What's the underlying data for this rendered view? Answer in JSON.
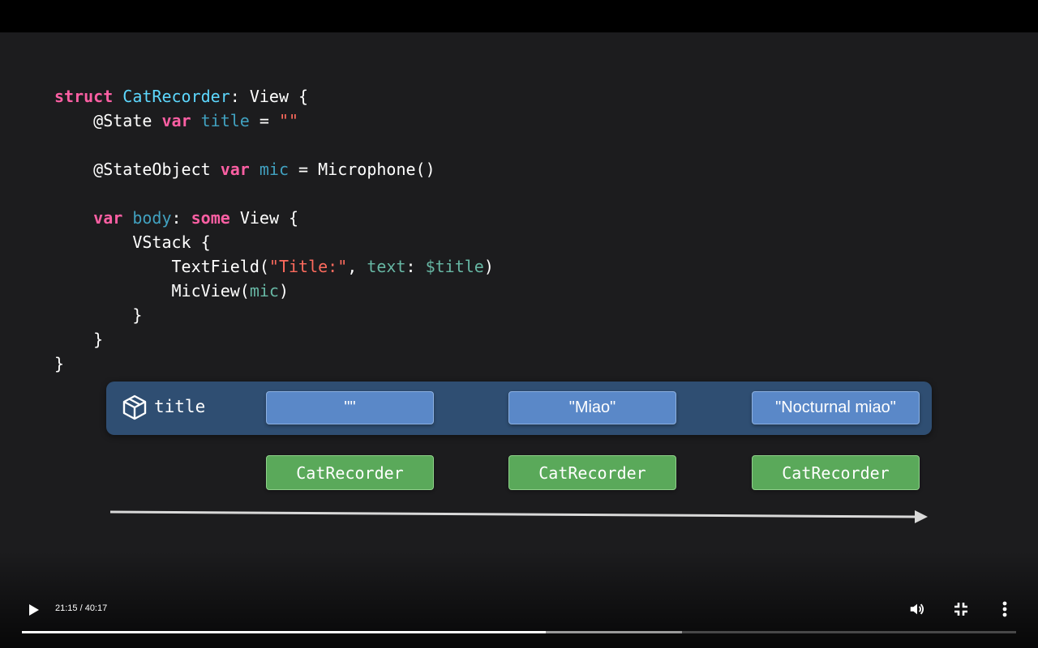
{
  "code": {
    "lines": [
      [
        {
          "c": "k",
          "t": "struct"
        },
        {
          "c": "w",
          "t": " "
        },
        {
          "c": "t",
          "t": "CatRecorder"
        },
        {
          "c": "w",
          "t": ": View {"
        }
      ],
      [
        {
          "c": "w",
          "t": "    @State "
        },
        {
          "c": "k",
          "t": "var"
        },
        {
          "c": "w",
          "t": " "
        },
        {
          "c": "v",
          "t": "title"
        },
        {
          "c": "w",
          "t": " = "
        },
        {
          "c": "s",
          "t": "\"\""
        }
      ],
      [
        {
          "c": "w",
          "t": ""
        }
      ],
      [
        {
          "c": "w",
          "t": "    @StateObject "
        },
        {
          "c": "k",
          "t": "var"
        },
        {
          "c": "w",
          "t": " "
        },
        {
          "c": "v",
          "t": "mic"
        },
        {
          "c": "w",
          "t": " = Microphone()"
        }
      ],
      [
        {
          "c": "w",
          "t": ""
        }
      ],
      [
        {
          "c": "w",
          "t": "    "
        },
        {
          "c": "k",
          "t": "var"
        },
        {
          "c": "w",
          "t": " "
        },
        {
          "c": "v",
          "t": "body"
        },
        {
          "c": "w",
          "t": ": "
        },
        {
          "c": "k",
          "t": "some"
        },
        {
          "c": "w",
          "t": " View {"
        }
      ],
      [
        {
          "c": "w",
          "t": "        VStack {"
        }
      ],
      [
        {
          "c": "w",
          "t": "            TextField("
        },
        {
          "c": "s",
          "t": "\"Title:\""
        },
        {
          "c": "w",
          "t": ", "
        },
        {
          "c": "p",
          "t": "text"
        },
        {
          "c": "w",
          "t": ": "
        },
        {
          "c": "p",
          "t": "$title"
        },
        {
          "c": "w",
          "t": ")"
        }
      ],
      [
        {
          "c": "w",
          "t": "            MicView("
        },
        {
          "c": "p",
          "t": "mic"
        },
        {
          "c": "w",
          "t": ")"
        }
      ],
      [
        {
          "c": "w",
          "t": "        }"
        }
      ],
      [
        {
          "c": "w",
          "t": "    }"
        }
      ],
      [
        {
          "c": "w",
          "t": "}"
        }
      ]
    ]
  },
  "diagram": {
    "state_label": "title",
    "state_icon": "cube-icon",
    "values": [
      "\"\"",
      "\"Miao\"",
      "\"Nocturnal miao\""
    ],
    "recorder_label": "CatRecorder"
  },
  "player": {
    "time_display": "21:15 / 40:17",
    "played_fraction": 0.527,
    "buffered_fraction": 0.664,
    "icons": {
      "play": "play-icon",
      "volume": "volume-icon",
      "exit_fullscreen": "exit-fullscreen-icon",
      "more": "more-vert-icon"
    }
  },
  "colors": {
    "keyword": "#fc5fa3",
    "type": "#5dd8ff",
    "property": "#41a1c0",
    "string": "#fc6a5d",
    "param": "#67b7a4",
    "state_bar": "#2f4e72",
    "value_box": "#5a88c8",
    "recorder_box": "#5aa95a"
  }
}
